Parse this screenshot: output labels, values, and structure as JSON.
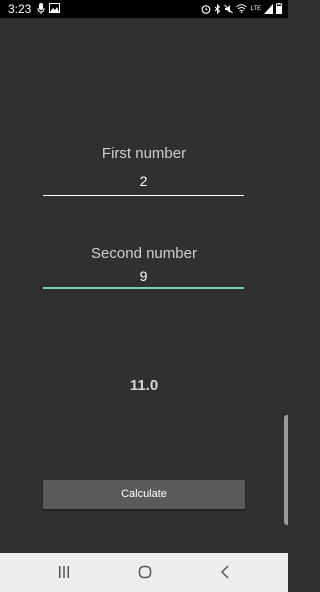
{
  "status_bar": {
    "time": "3:23",
    "network": "LTE",
    "left_icons": [
      "microphone-icon",
      "image-icon"
    ],
    "right_icons": [
      "alarm-icon",
      "bluetooth-icon",
      "mute-icon",
      "wifi-icon",
      "signal-icon",
      "battery-icon"
    ]
  },
  "form": {
    "first_label": "First number",
    "first_value": "2",
    "second_label": "Second number",
    "second_value": "9"
  },
  "result": "11.0",
  "button": {
    "calculate_label": "Calculate"
  },
  "nav_bar": {
    "icons": [
      "recent-apps-icon",
      "home-icon",
      "back-icon"
    ]
  },
  "colors": {
    "background": "#303030",
    "accent_underline": "#80cbc4",
    "underline": "#ffffff",
    "button": "#5a5a5a",
    "status_bar": "#000000",
    "nav_bar": "#ededed"
  }
}
